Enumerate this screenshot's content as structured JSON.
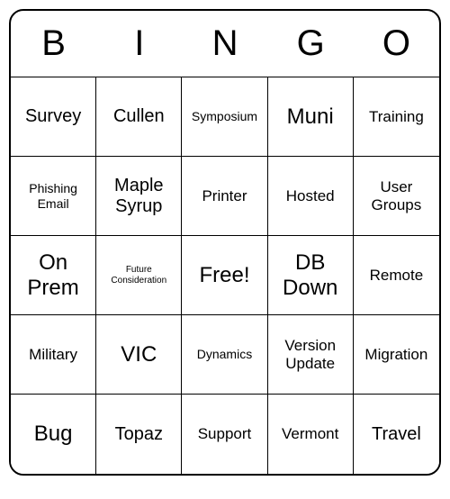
{
  "header": [
    "B",
    "I",
    "N",
    "G",
    "O"
  ],
  "cells": [
    {
      "text": "Survey",
      "size": "fs-lg"
    },
    {
      "text": "Cullen",
      "size": "fs-lg"
    },
    {
      "text": "Symposium",
      "size": "fs-sm"
    },
    {
      "text": "Muni",
      "size": "fs-xl"
    },
    {
      "text": "Training",
      "size": "fs-md"
    },
    {
      "text": "Phishing Email",
      "size": "fs-sm"
    },
    {
      "text": "Maple Syrup",
      "size": "fs-lg"
    },
    {
      "text": "Printer",
      "size": "fs-md"
    },
    {
      "text": "Hosted",
      "size": "fs-md"
    },
    {
      "text": "User Groups",
      "size": "fs-md"
    },
    {
      "text": "On Prem",
      "size": "fs-xl"
    },
    {
      "text": "Future Consideration",
      "size": "fs-xs"
    },
    {
      "text": "Free!",
      "size": "fs-xl"
    },
    {
      "text": "DB Down",
      "size": "fs-xl"
    },
    {
      "text": "Remote",
      "size": "fs-md"
    },
    {
      "text": "Military",
      "size": "fs-md"
    },
    {
      "text": "VIC",
      "size": "fs-xl"
    },
    {
      "text": "Dynamics",
      "size": "fs-sm"
    },
    {
      "text": "Version Update",
      "size": "fs-md"
    },
    {
      "text": "Migration",
      "size": "fs-md"
    },
    {
      "text": "Bug",
      "size": "fs-xl"
    },
    {
      "text": "Topaz",
      "size": "fs-lg"
    },
    {
      "text": "Support",
      "size": "fs-md"
    },
    {
      "text": "Vermont",
      "size": "fs-md"
    },
    {
      "text": "Travel",
      "size": "fs-lg"
    }
  ]
}
